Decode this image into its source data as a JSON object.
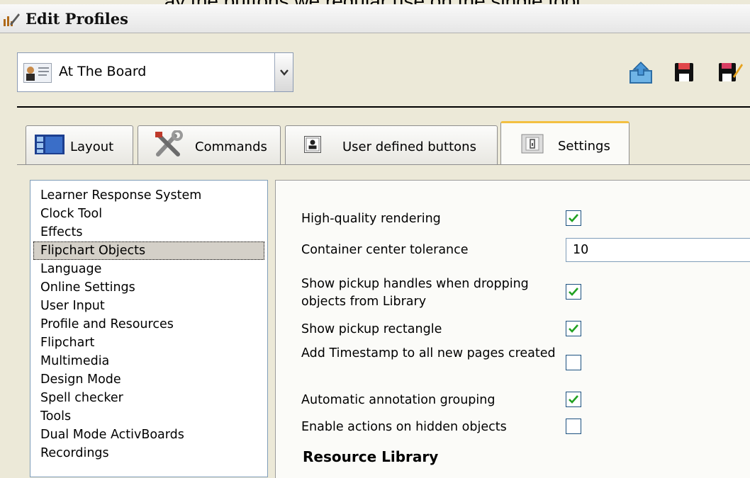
{
  "window": {
    "title": "Edit Profiles",
    "clipped_top_text": "ay the buttons we regular use on the single tool."
  },
  "profile": {
    "selected": "At The Board"
  },
  "toolbar": {
    "icons": [
      "export-profile-icon",
      "save-profile-icon",
      "rename-profile-icon"
    ]
  },
  "tabs": [
    {
      "label": "Layout",
      "icon": "layout-icon",
      "active": false
    },
    {
      "label": "Commands",
      "icon": "tools-icon",
      "active": false
    },
    {
      "label": "User defined buttons",
      "icon": "user-button-icon",
      "active": false
    },
    {
      "label": "Settings",
      "icon": "settings-icon",
      "active": true
    }
  ],
  "categories": [
    "Learner Response System",
    "Clock Tool",
    "Effects",
    "Flipchart Objects",
    "Language",
    "Online Settings",
    "User Input",
    "Profile and Resources",
    "Flipchart",
    "Multimedia",
    "Design Mode",
    "Spell checker",
    "Tools",
    "Dual Mode ActivBoards",
    "Recordings"
  ],
  "selected_category": "Flipchart Objects",
  "settings": {
    "high_quality_rendering": {
      "label": "High-quality rendering",
      "checked": true
    },
    "container_center_tolerance": {
      "label": "Container center tolerance",
      "value": "10"
    },
    "show_pickup_handles": {
      "label": "Show pickup handles when dropping objects from Library",
      "checked": true
    },
    "show_pickup_rectangle": {
      "label": "Show pickup rectangle",
      "checked": true
    },
    "add_timestamp": {
      "label": "Add Timestamp to all new pages created",
      "checked": false
    },
    "automatic_annotation_grouping": {
      "label": "Automatic annotation grouping",
      "checked": true
    },
    "enable_actions_hidden": {
      "label": "Enable actions on hidden objects",
      "checked": false
    },
    "section_heading": "Resource Library"
  },
  "colors": {
    "active_tab_accent": "#f3c041",
    "checkmark": "#21a121",
    "window_background": "#ece9d8"
  }
}
